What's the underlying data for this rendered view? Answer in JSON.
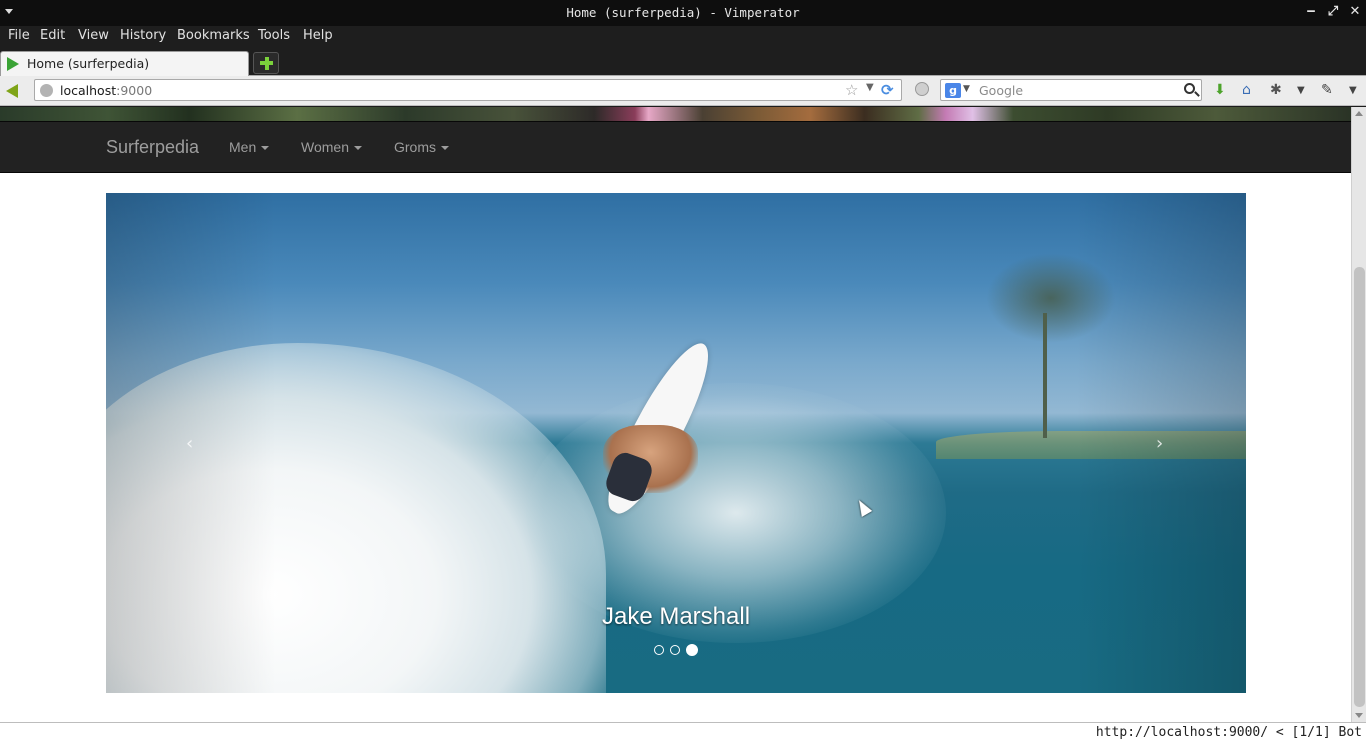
{
  "window": {
    "title": "Home (surferpedia) - Vimperator",
    "minimize_label": "‒",
    "maximize_label": "⤢",
    "close_label": "✕"
  },
  "menubar": {
    "items": [
      "File",
      "Edit",
      "View",
      "History",
      "Bookmarks",
      "Tools",
      "Help"
    ]
  },
  "tabs": [
    {
      "label": "Home (surferpedia)"
    }
  ],
  "navbar": {
    "url_host": "localhost",
    "url_port": ":9000",
    "search_placeholder": "Google",
    "search_engine_letter": "g"
  },
  "site": {
    "brand": "Surferpedia",
    "nav": [
      {
        "label": "Men"
      },
      {
        "label": "Women"
      },
      {
        "label": "Groms"
      }
    ]
  },
  "carousel": {
    "caption": "Jake Marshall",
    "prev_label": "‹",
    "next_label": "›",
    "slide_count": 3,
    "active_index": 2
  },
  "statusbar": {
    "text": "http://localhost:9000/ < [1/1] Bot"
  },
  "colors": {
    "navbar_bg": "#222222",
    "nav_text": "#9d9d9d",
    "browser_chrome": "#1e1e1e"
  }
}
